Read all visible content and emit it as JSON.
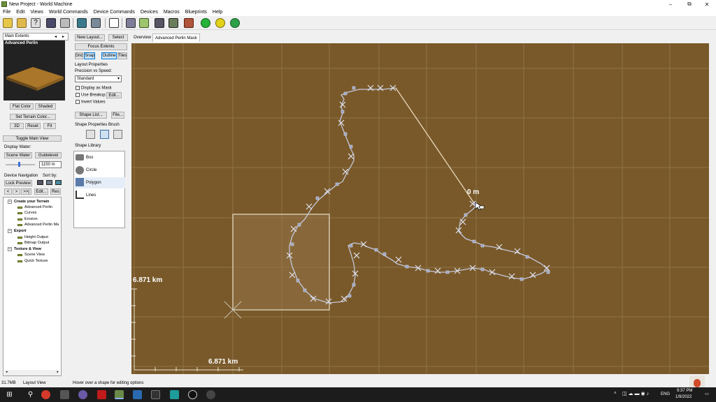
{
  "window": {
    "title": "New Project - World Machine",
    "minimize": "–",
    "maximize": "⧉",
    "close": "✕"
  },
  "menu": [
    "File",
    "Edit",
    "Views",
    "World Commands",
    "Device Commands",
    "Devices",
    "Macros",
    "Blueprints",
    "Help"
  ],
  "toolbar_icons": [
    "new-project-icon",
    "open-icon",
    "help-icon",
    "save-icon",
    "tool-icon",
    "build-icon",
    "explorer-icon",
    "layout-icon",
    "device-view-icon",
    "render-icon",
    "terrain-icon",
    "texture-icon",
    "green-build-icon",
    "yellow-build-icon",
    "globe-build-icon"
  ],
  "preview": {
    "header": "Main Extents",
    "device": "Advanced Perlin",
    "flat_color": "Flat Color",
    "shaded": "Shaded",
    "set_terrain_color": "Set Terrain Color...",
    "btn_3d": "3D",
    "reset": "Reset",
    "fit": "Fit",
    "toggle_main_view": "Toggle Main View"
  },
  "display_water": {
    "label": "Display Water:",
    "scene_water": "Scene Water",
    "guidelevel": "Guidelevel",
    "value": "1150 m"
  },
  "device_navigation": {
    "label": "Device Navigation",
    "sort_by": "Sort by:",
    "lock_preview": "Lock Preview",
    "prev": "<",
    "next": ">",
    "last": ">>|",
    "edit": "Edit...",
    "res": "Res"
  },
  "tree": [
    {
      "label": "Create your Terrain",
      "group": true
    },
    {
      "label": "Advanced Perlin",
      "group": false
    },
    {
      "label": "Curves",
      "group": false
    },
    {
      "label": "Erosion",
      "group": false
    },
    {
      "label": "Advanced Perlin Ma",
      "group": false
    },
    {
      "label": "Export",
      "group": true
    },
    {
      "label": "Height Output",
      "group": false
    },
    {
      "label": "Bitmap Output",
      "group": false
    },
    {
      "label": "Texture & View",
      "group": true
    },
    {
      "label": "Scene View",
      "group": false
    },
    {
      "label": "Quick Texture",
      "group": false
    }
  ],
  "layout_panel": {
    "new_layout": "New Layout...",
    "select": "Select",
    "focus_extents": "Focus Extents",
    "grid": "Grid",
    "snap": "Snap",
    "outline": "Outline",
    "tiles": "Tiles",
    "layout_properties": "Layout Properties",
    "precision_label": "Precision vs Speed:",
    "precision_value": "Standard",
    "display_as_mask": "Display as Mask",
    "use_breakup": "Use Breakup",
    "edit": "Edit...",
    "invert_values": "Invert Values",
    "shape_list": "Shape List...",
    "file": "File...",
    "shape_props": "Shape Properties Brush",
    "shape_library": "Shape Library",
    "shapes": [
      "Box",
      "Circle",
      "Polygon",
      "Lines"
    ]
  },
  "tabs": [
    "Overview",
    "Advanced Perlin Mask"
  ],
  "canvas": {
    "dim_vertical": "6.871 km",
    "dim_horizontal": "6.871 km",
    "cursor_distance": "0 m"
  },
  "status": {
    "memory": "31.7MB",
    "view": "Layout View",
    "hint": "Hover over a shape for editing options"
  },
  "taskbar": {
    "lang": "ENG",
    "time": "9:37 PM",
    "date": "1/9/2022"
  },
  "colors": {
    "canvas": "#79592a",
    "grid": "#8e7346",
    "path": "#c4c8dc",
    "box": "#d9d4c3"
  }
}
